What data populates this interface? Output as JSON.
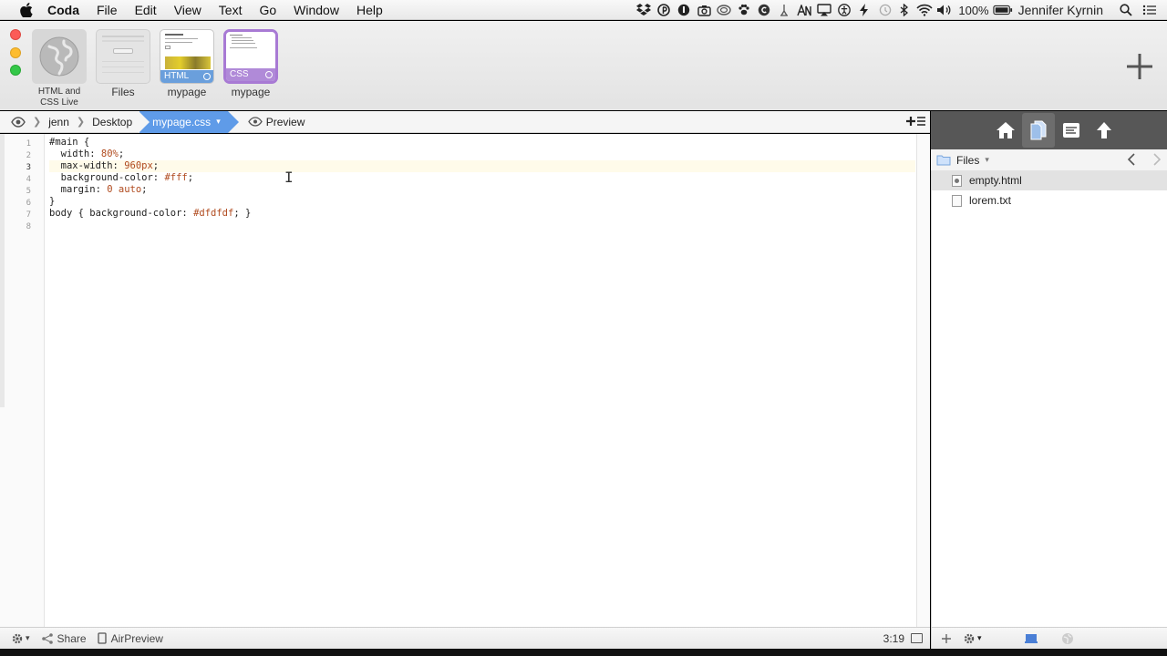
{
  "menubar": {
    "app_name": "Coda",
    "items": [
      "File",
      "Edit",
      "View",
      "Text",
      "Go",
      "Window",
      "Help"
    ],
    "battery": "100%",
    "user": "Jennifer Kyrnin"
  },
  "sites": [
    {
      "label": "HTML and CSS Live",
      "kind": "globe"
    },
    {
      "label": "Files",
      "kind": "files"
    },
    {
      "label": "mypage",
      "kind": "html",
      "tag": "HTML"
    },
    {
      "label": "mypage",
      "kind": "css",
      "tag": "CSS"
    }
  ],
  "pathbar": {
    "crumbs": [
      "jenn",
      "Desktop"
    ],
    "active_file": "mypage.css",
    "preview_label": "Preview"
  },
  "editor": {
    "current_line": 3,
    "lines": [
      [
        {
          "t": "#main {",
          "c": "kw"
        }
      ],
      [
        {
          "t": "  width: ",
          "c": "prop"
        },
        {
          "t": "80%",
          "c": "val"
        },
        {
          "t": ";",
          "c": "prop"
        }
      ],
      [
        {
          "t": "  max-width: ",
          "c": "prop"
        },
        {
          "t": "960px",
          "c": "val"
        },
        {
          "t": ";",
          "c": "prop"
        }
      ],
      [
        {
          "t": "  background-color: ",
          "c": "prop"
        },
        {
          "t": "#fff",
          "c": "val"
        },
        {
          "t": ";",
          "c": "prop"
        }
      ],
      [
        {
          "t": "  margin: ",
          "c": "prop"
        },
        {
          "t": "0",
          "c": "val"
        },
        {
          "t": " auto",
          "c": "val"
        },
        {
          "t": ";",
          "c": "prop"
        }
      ],
      [
        {
          "t": "}",
          "c": "kw"
        }
      ],
      [
        {
          "t": "body { ",
          "c": "kw"
        },
        {
          "t": "background-color: ",
          "c": "prop"
        },
        {
          "t": "#dfdfdf",
          "c": "val"
        },
        {
          "t": "; }",
          "c": "kw"
        }
      ],
      [
        {
          "t": "",
          "c": "kw"
        }
      ]
    ]
  },
  "bottombar": {
    "share_label": "Share",
    "airpreview_label": "AirPreview",
    "cursor_position": "3:19"
  },
  "sidebar": {
    "header_label": "Files",
    "files": [
      {
        "name": "empty.html",
        "type": "html",
        "selected": true
      },
      {
        "name": "lorem.txt",
        "type": "txt",
        "selected": false
      }
    ]
  },
  "colors": {
    "accent": "#5f9be8",
    "css_tag": "#b08ad8",
    "html_tag": "#6a9fdc",
    "value_text": "#b04a1e"
  }
}
